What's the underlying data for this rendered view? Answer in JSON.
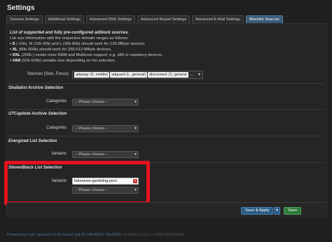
{
  "page": {
    "title": "Settings"
  },
  "tabs": [
    {
      "label": "General Settings",
      "active": false
    },
    {
      "label": "Additional Settings",
      "active": false
    },
    {
      "label": "Advanced DNS Settings",
      "active": false
    },
    {
      "label": "Advanced Report Settings",
      "active": false
    },
    {
      "label": "Advanced E-Mail Settings",
      "active": false
    },
    {
      "label": "Blocklist Sources",
      "active": true
    }
  ],
  "info": {
    "title": "List of supported and fully pre-configured adblock sources.",
    "lines": [
      {
        "prefix": "",
        "text": "List size information with the respective domain ranges as follows:"
      },
      {
        "prefix": "• S",
        "text": " (-10k), M (10k-30k) and L (30k-80k) should work for 128 MByte devices,"
      },
      {
        "prefix": "• XL",
        "text": " (80k-200k) should work for 256-512 MByte devices,"
      },
      {
        "prefix": "• XXL",
        "text": " (200k-) needs more RAM and Multicore support, e.g. x86 or raspberry devices."
      },
      {
        "prefix": "• VAR",
        "text": " (50k-500k) variable size depending on the selection."
      }
    ]
  },
  "sources": {
    "label": "Sources (Size, Focus)",
    "chips": [
      "adaway (S, mobile)",
      "adguard (L, general)",
      "disconnect (S, general"
    ],
    "more": "..."
  },
  "shallalist": {
    "title": "Shallalist Archive Selection",
    "label": "Categories",
    "placeholder": "-- Please choose --"
  },
  "utcapitole": {
    "title": "UTCapitole Archive Selection",
    "label": "Categories",
    "placeholder": "-- Please choose --"
  },
  "energized": {
    "title": "Energized List Selection",
    "label": "Variants",
    "placeholder": "-- Please choose --"
  },
  "stevenblack": {
    "title": "StevenBlack List Selection",
    "label": "Variants",
    "selected_value": "fakenews-gambling-porn",
    "remove_glyph": "×",
    "placeholder": "-- Please choose --"
  },
  "actions": {
    "save_apply_label": "Save & Apply",
    "dropdown_glyph": "▾",
    "save_label": "Save"
  },
  "footer": {
    "text": "Powered by LuCI openwrt-21.02 branch (git-22.046.85957-59c3392)",
    "dim_text": "OpenWrt 21.02.2 r16495-bf0c965af0"
  },
  "colors": {
    "background": "#1f1f1f",
    "active_tab": "#3a5a78",
    "highlight_border": "#e8121d",
    "save_apply": "#2b5d86",
    "save": "#2f7a3a",
    "remove": "#c9302c",
    "footer_link": "#4a78a6"
  }
}
